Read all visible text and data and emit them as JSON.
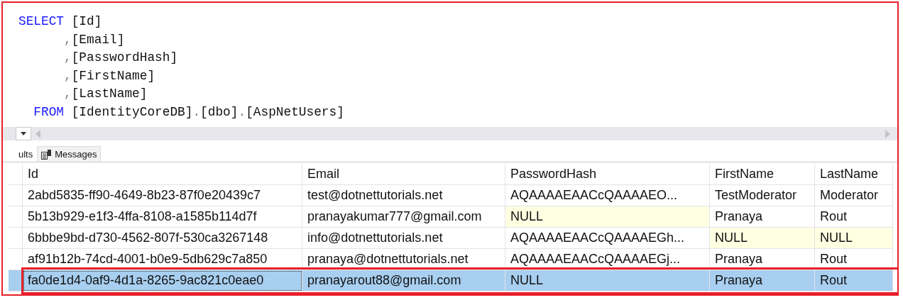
{
  "editor": {
    "lines": [
      [
        {
          "text": "SELECT",
          "kind": "keyword"
        },
        {
          "text": " [Id]",
          "kind": "plain"
        }
      ],
      [
        {
          "text": "      ,",
          "kind": "punct"
        },
        {
          "text": "[Email]",
          "kind": "plain"
        }
      ],
      [
        {
          "text": "      ,",
          "kind": "punct"
        },
        {
          "text": "[PasswordHash]",
          "kind": "plain"
        }
      ],
      [
        {
          "text": "      ,",
          "kind": "punct"
        },
        {
          "text": "[FirstName]",
          "kind": "plain"
        }
      ],
      [
        {
          "text": "      ,",
          "kind": "punct"
        },
        {
          "text": "[LastName]",
          "kind": "plain"
        }
      ],
      [
        {
          "text": "  FROM",
          "kind": "keyword"
        },
        {
          "text": " [IdentityCoreDB]",
          "kind": "plain"
        },
        {
          "text": ".",
          "kind": "punct"
        },
        {
          "text": "[dbo]",
          "kind": "plain"
        },
        {
          "text": ".",
          "kind": "punct"
        },
        {
          "text": "[AspNetUsers]",
          "kind": "plain"
        }
      ]
    ]
  },
  "tabs": [
    {
      "label": "ults",
      "selected": true
    },
    {
      "label": "Messages",
      "selected": false
    }
  ],
  "table": {
    "columns": [
      "Id",
      "Email",
      "PasswordHash",
      "FirstName",
      "LastName"
    ],
    "rows": [
      {
        "selected": false,
        "highlighted": false,
        "cells": [
          {
            "text": "2abd5835-ff90-4649-8b23-87f0e20439c7",
            "null": false,
            "focused": false
          },
          {
            "text": "test@dotnettutorials.net",
            "null": false,
            "focused": false
          },
          {
            "text": "AQAAAAEAACcQAAAAEO...",
            "null": false,
            "focused": false
          },
          {
            "text": "TestModerator",
            "null": false,
            "focused": false
          },
          {
            "text": "Moderator",
            "null": false,
            "focused": false
          }
        ]
      },
      {
        "selected": false,
        "highlighted": false,
        "cells": [
          {
            "text": "5b13b929-e1f3-4ffa-8108-a1585b114d7f",
            "null": false,
            "focused": false
          },
          {
            "text": "pranayakumar777@gmail.com",
            "null": false,
            "focused": false
          },
          {
            "text": "NULL",
            "null": true,
            "focused": false
          },
          {
            "text": "Pranaya",
            "null": false,
            "focused": false
          },
          {
            "text": "Rout",
            "null": false,
            "focused": false
          }
        ]
      },
      {
        "selected": false,
        "highlighted": false,
        "cells": [
          {
            "text": "6bbbe9bd-d730-4562-807f-530ca3267148",
            "null": false,
            "focused": false
          },
          {
            "text": "info@dotnettutorials.net",
            "null": false,
            "focused": false
          },
          {
            "text": "AQAAAAEAACcQAAAAEGh...",
            "null": false,
            "focused": false
          },
          {
            "text": "NULL",
            "null": true,
            "focused": false
          },
          {
            "text": "NULL",
            "null": true,
            "focused": false
          }
        ]
      },
      {
        "selected": false,
        "highlighted": false,
        "cells": [
          {
            "text": "af91b12b-74cd-4001-b0e9-5db629c7a850",
            "null": false,
            "focused": false
          },
          {
            "text": "pranaya@dotnettutorials.net",
            "null": false,
            "focused": false
          },
          {
            "text": "AQAAAAEAACcQAAAAEGj...",
            "null": false,
            "focused": false
          },
          {
            "text": "Pranaya",
            "null": false,
            "focused": false
          },
          {
            "text": "Rout",
            "null": false,
            "focused": false
          }
        ]
      },
      {
        "selected": true,
        "highlighted": true,
        "cells": [
          {
            "text": "fa0de1d4-0af9-4d1a-8265-9ac821c0eae0",
            "focused": true
          },
          {
            "text": "pranayarout88@gmail.com",
            "focused": false
          },
          {
            "text": "NULL",
            "focused": false
          },
          {
            "text": "Pranaya",
            "focused": false
          },
          {
            "text": "Rout",
            "focused": false
          }
        ]
      }
    ]
  }
}
